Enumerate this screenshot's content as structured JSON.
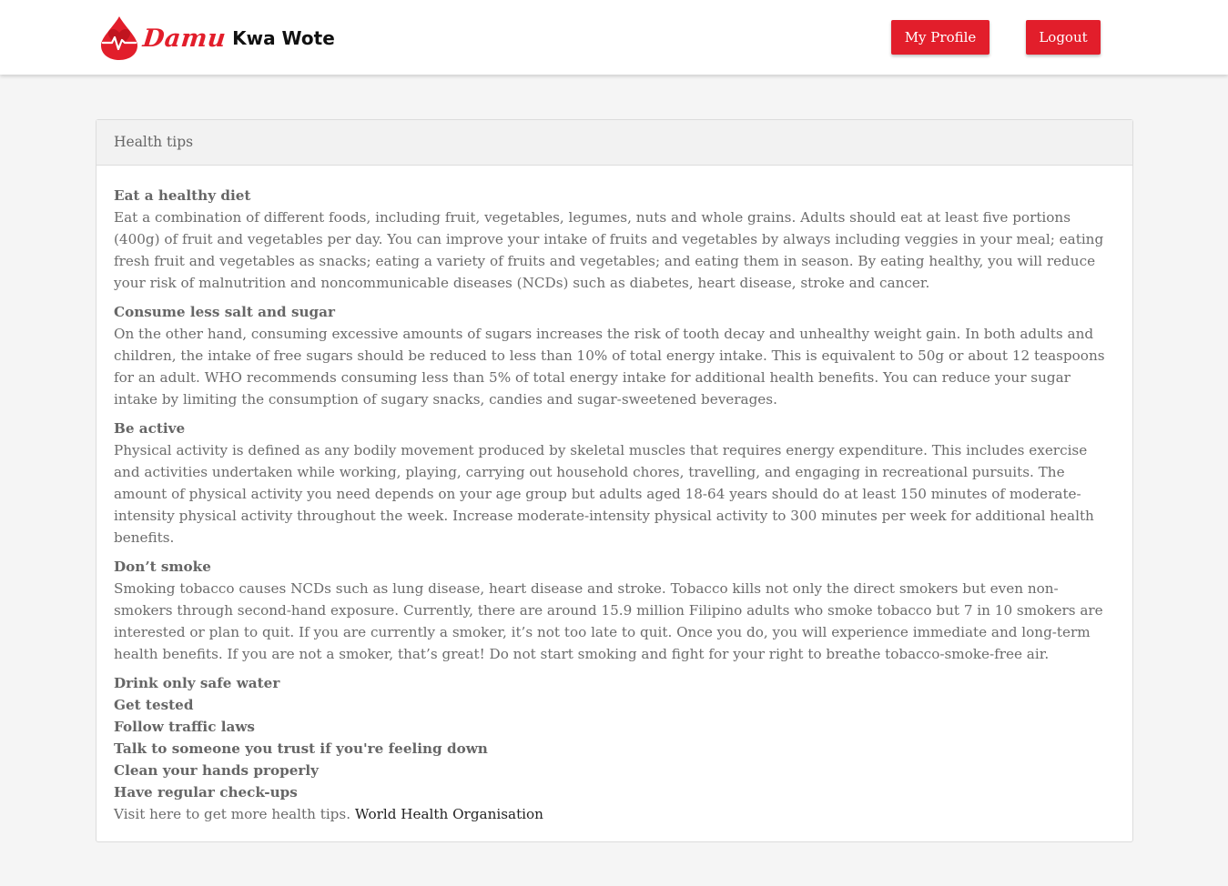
{
  "header": {
    "brand_script": "Damu",
    "brand_rest": "Kwa Wote",
    "profile_label": "My Profile",
    "logout_label": "Logout"
  },
  "card": {
    "title": "Health tips",
    "tips": [
      {
        "title": "Eat a healthy diet",
        "text": "Eat a combination of different foods, including fruit, vegetables, legumes, nuts and whole grains. Adults should eat at least five portions (400g) of fruit and vegetables per day. You can improve your intake of fruits and vegetables by always including veggies in your meal; eating fresh fruit and vegetables as snacks; eating a variety of fruits and vegetables; and eating them in season. By eating healthy, you will reduce your risk of malnutrition and noncommunicable diseases (NCDs) such as diabetes, heart disease, stroke and cancer."
      },
      {
        "title": "Consume less salt and sugar",
        "text": "On the other hand, consuming excessive amounts of sugars increases the risk of tooth decay and unhealthy weight gain. In both adults and children, the intake of free sugars should be reduced to less than 10% of total energy intake. This is equivalent to 50g or about 12 teaspoons for an adult. WHO recommends consuming less than 5% of total energy intake for additional health benefits. You can reduce your sugar intake by limiting the consumption of sugary snacks, candies and sugar-sweetened beverages."
      },
      {
        "title": "Be active",
        "text": "Physical activity is defined as any bodily movement produced by skeletal muscles that requires energy expenditure. This includes exercise and activities undertaken while working, playing, carrying out household chores, travelling, and engaging in recreational pursuits. The amount of physical activity you need depends on your age group but adults aged 18-64 years should do at least 150 minutes of moderate-intensity physical activity throughout the week. Increase moderate-intensity physical activity to 300 minutes per week for additional health benefits."
      },
      {
        "title": "Don’t smoke",
        "text": "Smoking tobacco causes NCDs such as lung disease, heart disease and stroke. Tobacco kills not only the direct smokers but even non-smokers through second-hand exposure. Currently, there are around 15.9 million Filipino adults who smoke tobacco but 7 in 10 smokers are interested or plan to quit. If you are currently a smoker, it’s not too late to quit. Once you do, you will experience immediate and long-term health benefits. If you are not a smoker, that’s great! Do not start smoking and fight for your right to breathe tobacco-smoke-free air."
      }
    ],
    "short_tips": [
      "Drink only safe water",
      "Get tested",
      "Follow traffic laws",
      "Talk to someone you trust if you're feeling down",
      "Clean your hands properly",
      "Have regular check-ups"
    ],
    "footer_text": "Visit here to get more health tips.",
    "footer_link": "World Health Organisation"
  },
  "colors": {
    "accent": "#e21e2b",
    "page_bg": "#f5f5f5"
  },
  "icons": {
    "logo": "blood-drop-heartbeat-icon"
  }
}
